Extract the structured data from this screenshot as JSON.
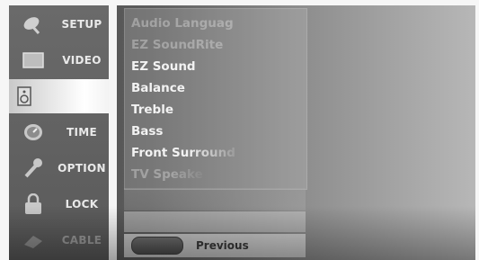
{
  "sidebar": {
    "items": [
      {
        "label": "SETUP",
        "icon": "satellite-dish-icon"
      },
      {
        "label": "VIDEO",
        "icon": "monitor-icon"
      },
      {
        "label": "",
        "icon": "speaker-icon"
      },
      {
        "label": "TIME",
        "icon": "clock-icon"
      },
      {
        "label": "OPTION",
        "icon": "wrench-icon"
      },
      {
        "label": "LOCK",
        "icon": "padlock-icon"
      },
      {
        "label": "CABLE",
        "icon": "cable-icon"
      }
    ],
    "selected_index": 2
  },
  "audio_menu": {
    "items": [
      "Audio Languag",
      "EZ SoundRite",
      "EZ Sound",
      "Balance",
      "Treble",
      "Bass",
      "Front Surround",
      "TV Speake"
    ]
  },
  "footer": {
    "previous_label": "Previous"
  },
  "colors": {
    "highlight": "#ffffff",
    "menu_text": "#f2f2f2"
  }
}
